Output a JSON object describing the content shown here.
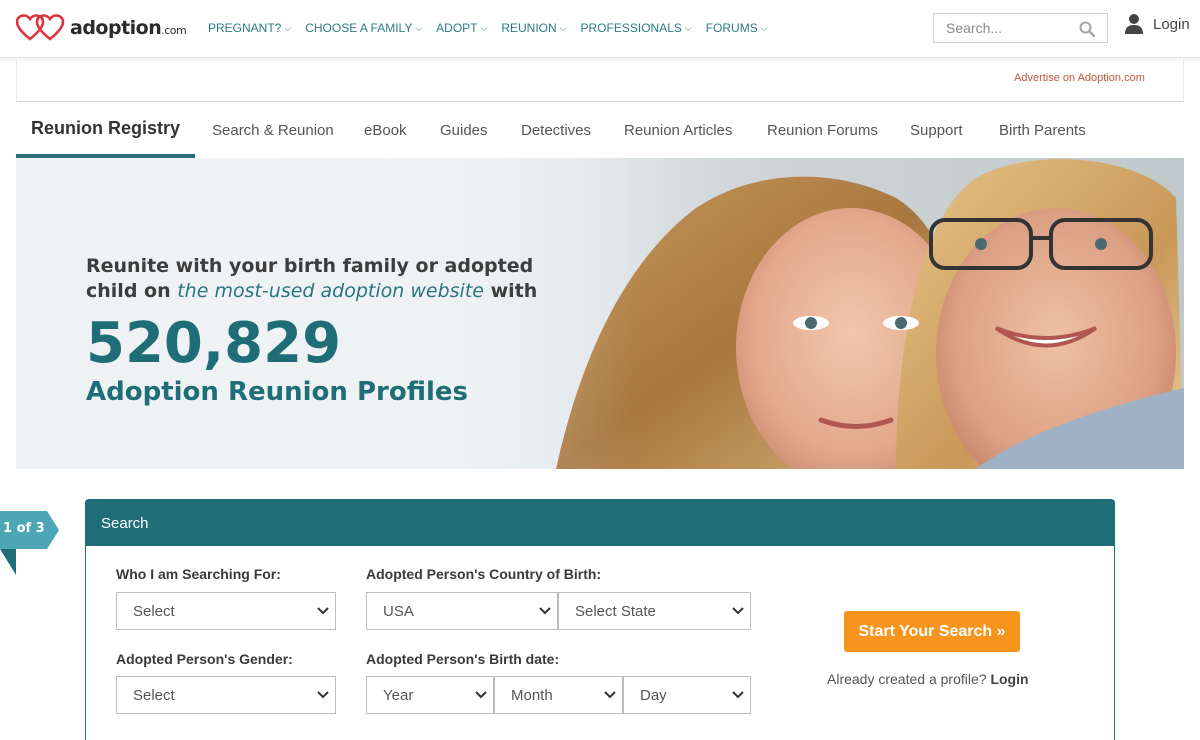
{
  "header": {
    "logo_text": "adoption",
    "logo_suffix": ".com",
    "nav": [
      {
        "label": "PREGNANT?"
      },
      {
        "label": "CHOOSE A FAMILY"
      },
      {
        "label": "ADOPT"
      },
      {
        "label": "REUNION"
      },
      {
        "label": "PROFESSIONALS"
      },
      {
        "label": "FORUMS"
      }
    ],
    "search_placeholder": "Search...",
    "login_label": "Login"
  },
  "advertise_link": "Advertise on Adoption.com",
  "subnav": {
    "active": "Reunion Registry",
    "tabs": [
      "Search & Reunion",
      "eBook",
      "Guides",
      "Detectives",
      "Reunion Articles",
      "Reunion Forums",
      "Support",
      "Birth Parents"
    ]
  },
  "hero": {
    "line1": "Reunite with your birth family or adopted",
    "line2_start": "child on ",
    "line2_em": "the most-used adoption website",
    "line2_end": " with",
    "count": "520,829",
    "subtitle": "Adoption Reunion Profiles"
  },
  "step_badge": "1 of 3",
  "search_panel": {
    "title": "Search",
    "who_label": "Who I am Searching For:",
    "who_value": "Select",
    "country_label": "Adopted Person's Country of Birth:",
    "country_value": "USA",
    "state_value": "Select State",
    "gender_label": "Adopted Person's Gender:",
    "gender_value": "Select",
    "birthdate_label": "Adopted Person's Birth date:",
    "year_value": "Year",
    "month_value": "Month",
    "day_value": "Day",
    "start_button": "Start Your Search »",
    "already_text": "Already created a profile?",
    "login_link": "Login"
  },
  "colors": {
    "teal": "#1f6e77",
    "nav_teal": "#2d7b86",
    "orange": "#f7941d",
    "logo_red": "#d9363e",
    "advertise": "#c0563a"
  }
}
